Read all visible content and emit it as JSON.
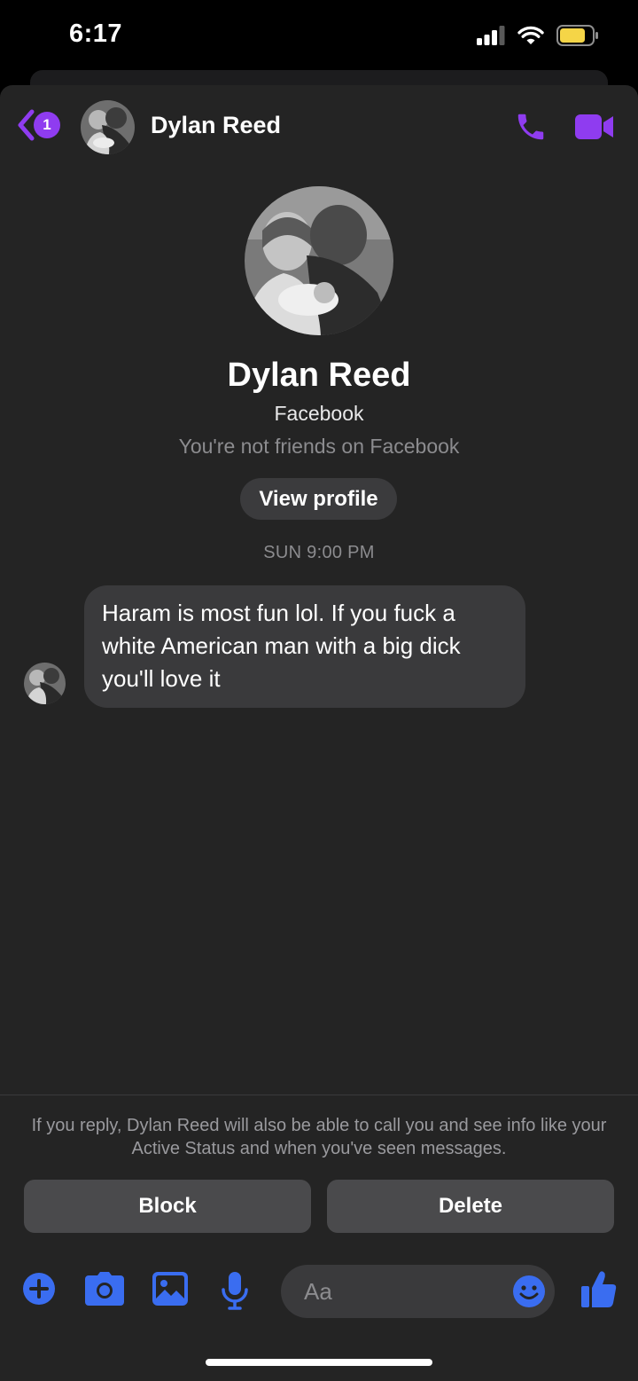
{
  "status_bar": {
    "time": "6:17"
  },
  "header": {
    "back_badge": "1",
    "contact_name": "Dylan Reed"
  },
  "profile": {
    "name": "Dylan Reed",
    "network": "Facebook",
    "friend_status": "You're not friends on Facebook",
    "view_profile_label": "View profile"
  },
  "conversation": {
    "timestamp": "SUN 9:00 PM",
    "messages": [
      {
        "text": "Haram is most fun lol. If you fuck a white American man with a big dick you'll love it"
      }
    ]
  },
  "request": {
    "notice": "If you reply, Dylan Reed will also be able to call you and see info like your Active Status and when you've seen messages.",
    "block_label": "Block",
    "delete_label": "Delete"
  },
  "composer": {
    "placeholder": "Aa"
  },
  "colors": {
    "accent_purple": "#8f3cf0",
    "composer_blue": "#3a6df0",
    "sheet_background": "#242424",
    "bubble_background": "#3a3a3c"
  }
}
